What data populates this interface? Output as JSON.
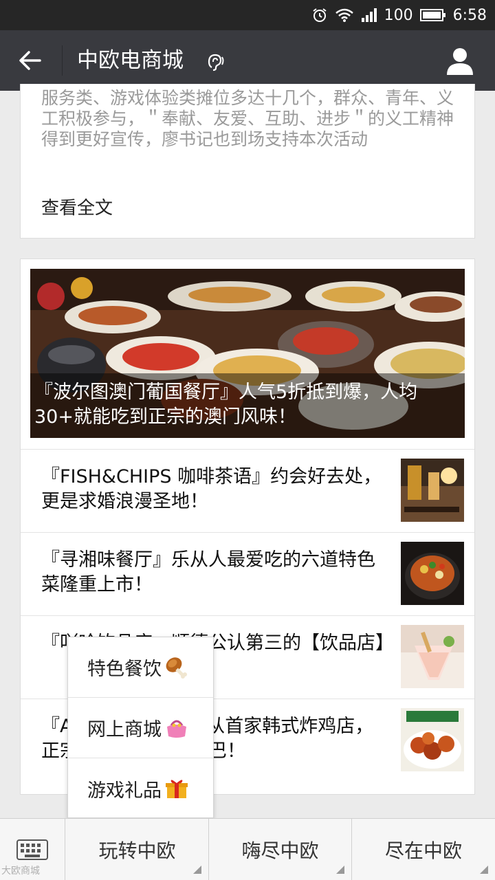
{
  "status_bar": {
    "battery_level": "100",
    "time": "6:58",
    "icons": [
      "alarm-icon",
      "wifi-icon",
      "signal-icon",
      "battery-icon"
    ]
  },
  "nav": {
    "title": "中欧电商城",
    "icons": [
      "back-arrow-icon",
      "ear-icon",
      "profile-icon"
    ]
  },
  "article": {
    "excerpt": "服务类、游戏体验类摊位多达十几个，群众、青年、义工积极参与，＂奉献、友爱、互助、进步＂的义工精神得到更好宣传，廖书记也到场支持本次活动",
    "read_more": "查看全文"
  },
  "news": {
    "hero_caption": "『波尔图澳门葡国餐厅』人气5折抵到爆，人均30+就能吃到正宗的澳门风味！",
    "items": [
      {
        "title": "『FISH&CHIPS 咖啡茶语』约会好去处，更是求婚浪漫圣地！"
      },
      {
        "title": "『寻湘味餐厅』乐从人最爱吃的六道特色菜隆重上市！"
      },
      {
        "title": "『吖哈饮品店』顺德公认第三的【饮品店】"
      },
      {
        "title": "『ATOM MEAT』乐从首家韩式炸鸡店，正宗的韩！国！欧！巴！"
      }
    ]
  },
  "popup_menu": {
    "items": [
      {
        "label": "特色餐饮",
        "icon": "drumstick-icon"
      },
      {
        "label": "网上商城",
        "icon": "purse-icon"
      },
      {
        "label": "游戏礼品",
        "icon": "gift-icon"
      }
    ]
  },
  "bottom_menu": {
    "items": [
      {
        "label": "玩转中欧"
      },
      {
        "label": "嗨尽中欧"
      },
      {
        "label": "尽在中欧"
      }
    ],
    "keyboard_icon": "keyboard-icon"
  },
  "watermark": "大欧商城"
}
